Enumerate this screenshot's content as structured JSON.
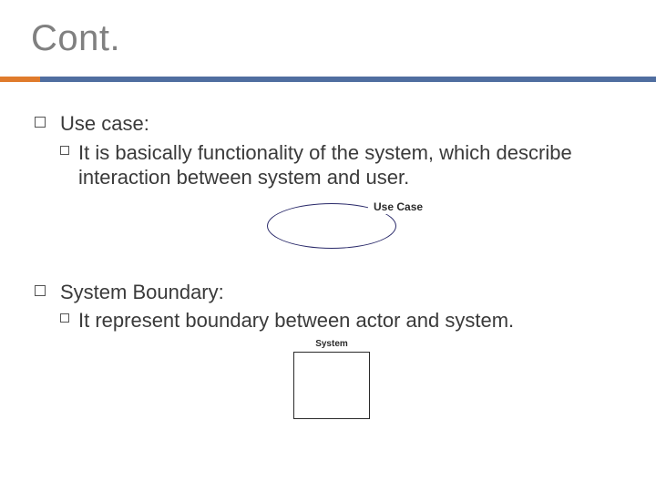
{
  "slide": {
    "title": "Cont."
  },
  "sections": [
    {
      "heading": "Use case:",
      "body": "It is basically functionality of the system, which describe interaction between system and user.",
      "figure_label": "Use Case"
    },
    {
      "heading": "System Boundary:",
      "body": "It represent boundary between actor and system.",
      "figure_label": "System"
    }
  ]
}
